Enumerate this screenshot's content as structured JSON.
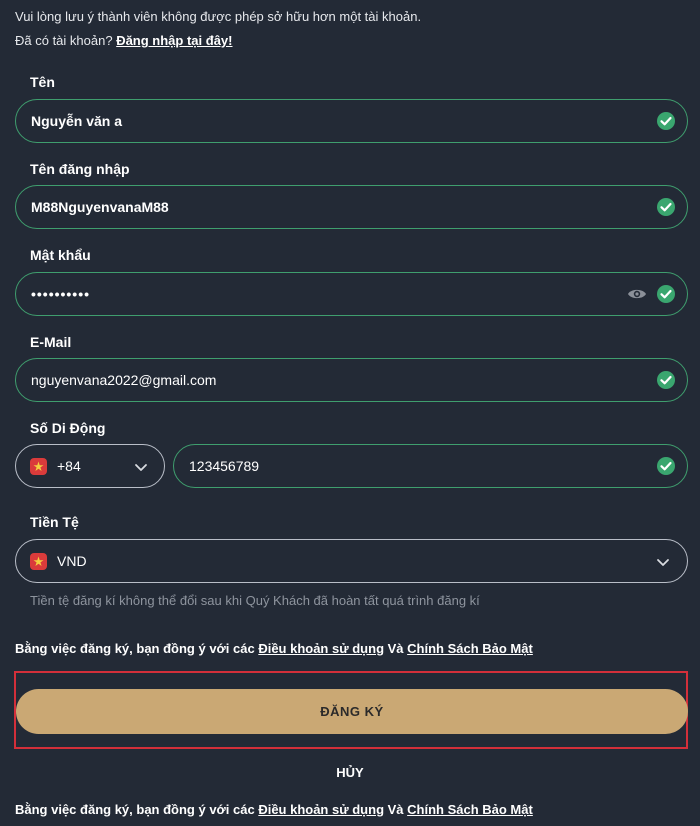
{
  "notice": {
    "line1": "Vui lòng lưu ý thành viên không được phép sở hữu hơn một tài khoản.",
    "line2_prefix": "Đã có tài khoản? ",
    "login_link": "Đăng nhập tại đây!"
  },
  "form": {
    "name": {
      "label": "Tên",
      "value": "Nguyễn văn a"
    },
    "username": {
      "label": "Tên đăng nhập",
      "value": "M88NguyenvanaM88"
    },
    "password": {
      "label": "Mật khẩu",
      "value": "••••••••••"
    },
    "email": {
      "label": "E-Mail",
      "value": "nguyenvana2022@gmail.com"
    },
    "phone": {
      "label": "Số Di Động",
      "country_code": "+84",
      "value": "123456789"
    },
    "currency": {
      "label": "Tiền Tệ",
      "value": "VND",
      "hint": "Tiền tệ đăng kí không thể đổi sau khi Quý Khách đã hoàn tất quá trình đăng kí"
    }
  },
  "terms": {
    "prefix": "Bằng việc đăng ký, bạn đồng ý với các ",
    "terms_link": "Điều khoản sử dụng",
    "and": " Và ",
    "privacy_link": "Chính Sách Bảo Mật"
  },
  "actions": {
    "submit_label": "ĐĂNG KÝ",
    "cancel_label": "HỦY"
  },
  "colors": {
    "background": "#232a36",
    "valid_border": "#3f9e6e",
    "check": "#3aa66f",
    "submit": "#caa874",
    "highlight": "#d32f3a"
  }
}
